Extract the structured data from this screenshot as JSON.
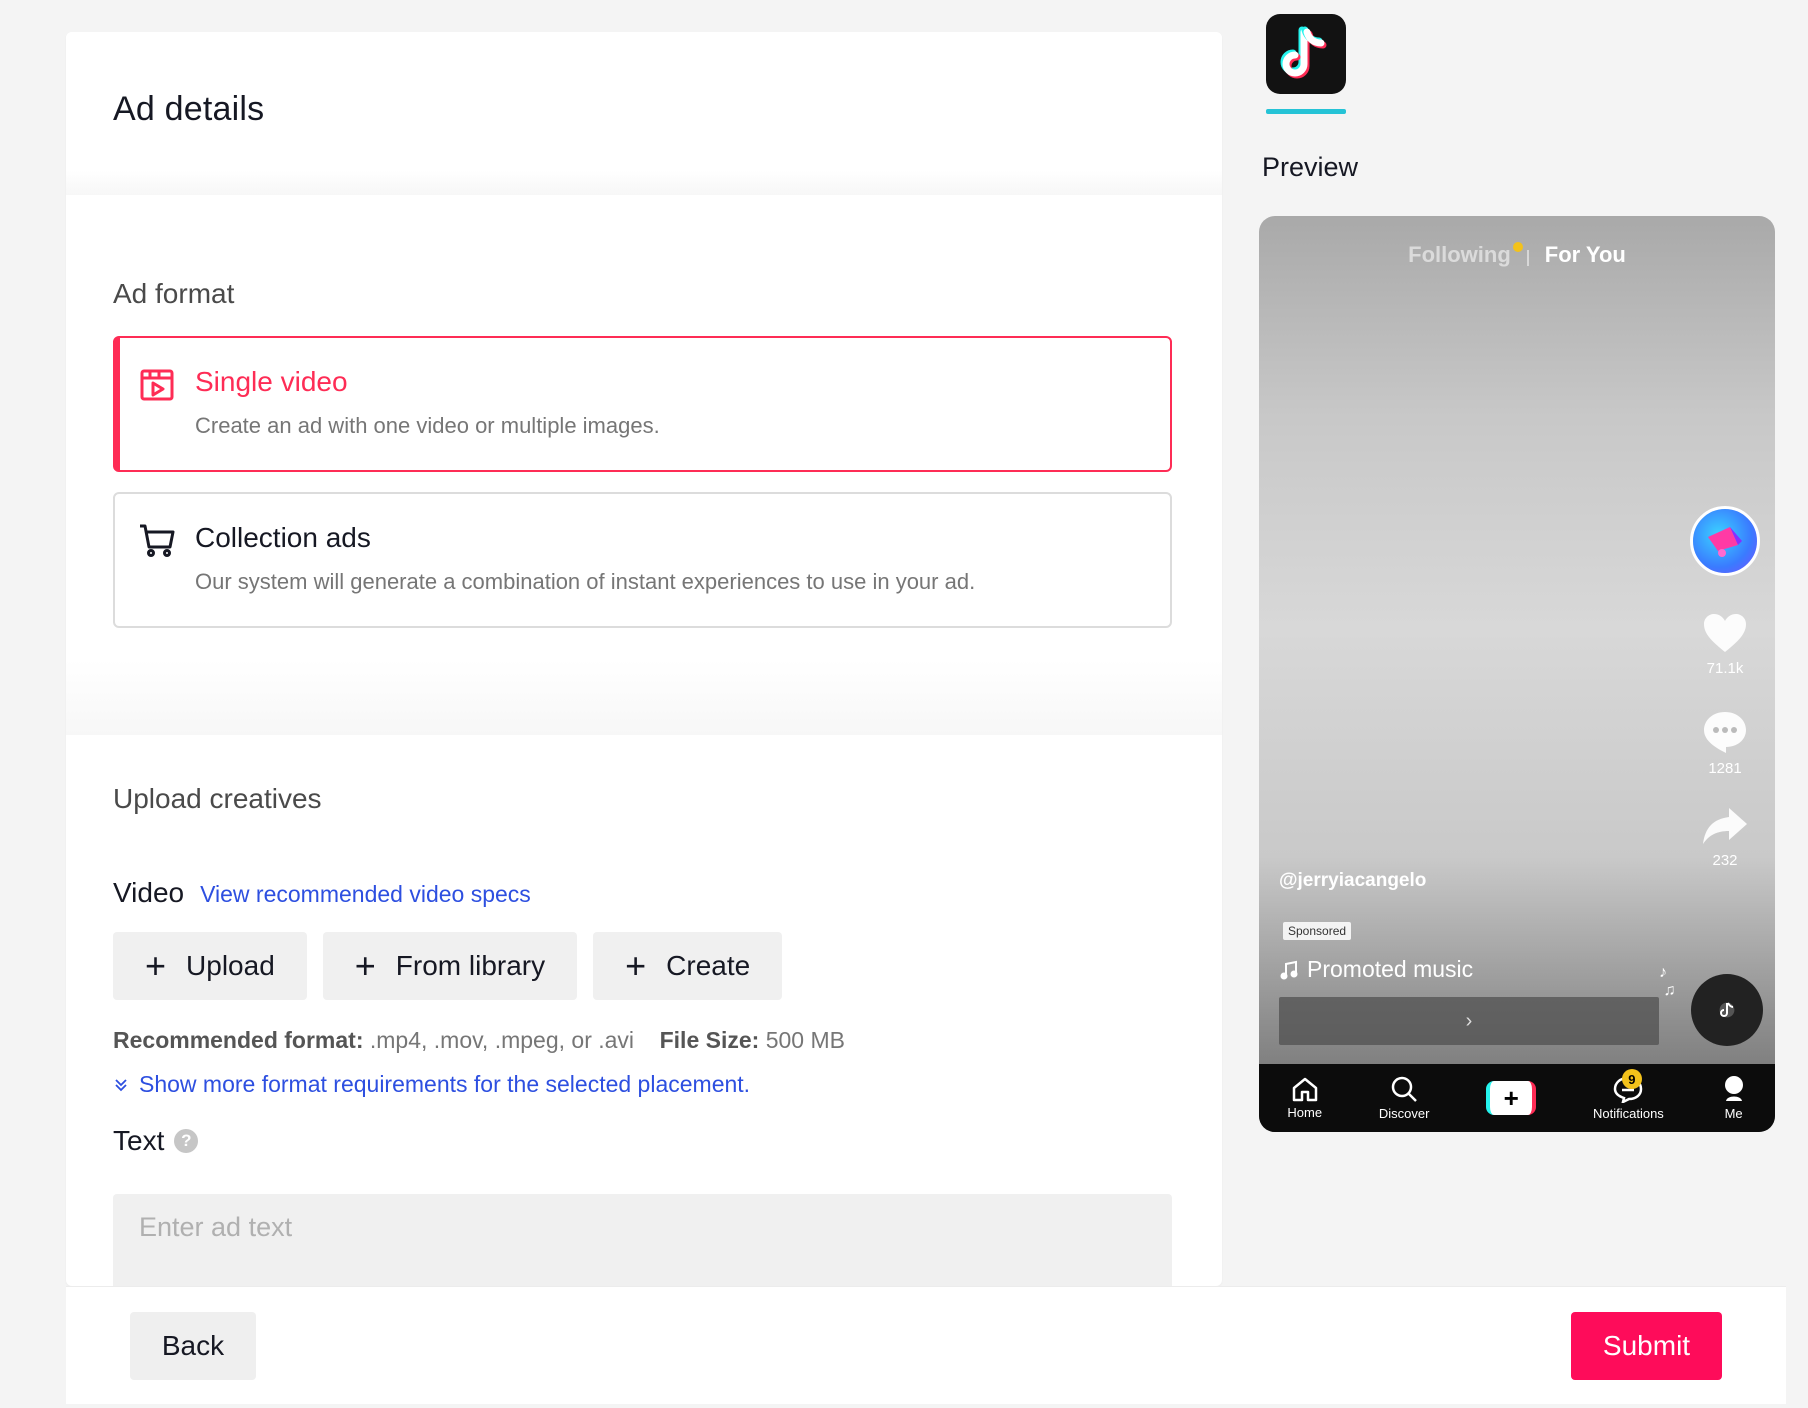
{
  "header": {
    "title": "Ad details"
  },
  "ad_format": {
    "title": "Ad format",
    "options": [
      {
        "title": "Single video",
        "description": "Create an ad with one video or multiple images.",
        "selected": true,
        "icon": "video-frame-icon"
      },
      {
        "title": "Collection ads",
        "description": "Our system will generate a combination of instant experiences to use in your ad.",
        "selected": false,
        "icon": "cart-icon"
      }
    ]
  },
  "upload": {
    "title": "Upload creatives",
    "video_label": "Video",
    "video_specs_link": "View recommended video specs",
    "buttons": {
      "upload": "Upload",
      "library": "From library",
      "create": "Create"
    },
    "format_label": "Recommended format:",
    "format_value": ".mp4, .mov, .mpeg, or .avi",
    "size_label": "File Size:",
    "size_value": "500 MB",
    "more_link": "Show more format requirements for the selected placement.",
    "text_label": "Text",
    "text_placeholder": "Enter ad text"
  },
  "footer": {
    "back": "Back",
    "submit": "Submit"
  },
  "preview": {
    "label": "Preview",
    "tab_following": "Following",
    "tab_for_you": "For You",
    "likes": "71.1k",
    "comments": "1281",
    "shares": "232",
    "username": "@jerryiacangelo",
    "sponsored": "Sponsored",
    "music": "Promoted music",
    "nav": {
      "home": "Home",
      "discover": "Discover",
      "notifications": "Notifications",
      "me": "Me",
      "notification_count": "9"
    }
  },
  "colors": {
    "accent": "#fe2c55",
    "submit": "#fe0c5a",
    "link": "#2d4fe0",
    "tab_underline": "#25c3d6"
  }
}
